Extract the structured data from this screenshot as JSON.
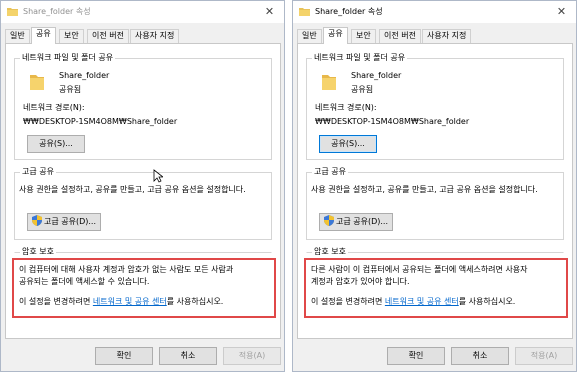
{
  "windows": [
    {
      "title": "Share_folder 속성",
      "close_glyph": "✕",
      "tabs": [
        "일반",
        "공유",
        "보안",
        "이전 버전",
        "사용자 지정"
      ],
      "network_share": {
        "group_label": "네트워크 파일 및 폴더 공유",
        "folder_name": "Share_folder",
        "folder_status": "공유됨",
        "path_label": "네트워크 경로(N):",
        "path_value": "₩₩DESKTOP-1SM4O8M₩Share_folder",
        "share_button": "공유(S)..."
      },
      "advanced_share": {
        "group_label": "고급 공유",
        "description": "사용 권한을 설정하고, 공유를 만들고, 고급 공유 옵션을 설정합니다.",
        "button": "고급 공유(D)..."
      },
      "password_protect": {
        "group_label": "암호 보호",
        "line1": "이 컴퓨터에 대해 사용자 계정과 암호가 없는 사람도 모든 사람과",
        "line2": "공유되는 폴더에 액세스할 수 있습니다.",
        "change_prefix": "이 설정을 변경하려면 ",
        "change_link": "네트워크 및 공유 센터",
        "change_suffix": "를 사용하십시오."
      },
      "footer": {
        "ok": "확인",
        "cancel": "취소",
        "apply": "적용(A)"
      }
    },
    {
      "title": "Share_folder 속성",
      "close_glyph": "✕",
      "tabs": [
        "일반",
        "공유",
        "보안",
        "이전 버전",
        "사용자 지정"
      ],
      "network_share": {
        "group_label": "네트워크 파일 및 폴더 공유",
        "folder_name": "Share_folder",
        "folder_status": "공유됨",
        "path_label": "네트워크 경로(N):",
        "path_value": "₩₩DESKTOP-1SM4O8M₩Share_folder",
        "share_button": "공유(S)..."
      },
      "advanced_share": {
        "group_label": "고급 공유",
        "description": "사용 권한을 설정하고, 공유를 만들고, 고급 공유 옵션을 설정합니다.",
        "button": "고급 공유(D)..."
      },
      "password_protect": {
        "group_label": "암호 보호",
        "line1": "다른 사람이 이 컴퓨터에서 공유되는 폴더에 액세스하려면 사용자",
        "line2": "계정과 암호가 있어야 합니다.",
        "change_prefix": "이 설정을 변경하려면 ",
        "change_link": "네트워크 및 공유 센터",
        "change_suffix": "를 사용하십시오."
      },
      "footer": {
        "ok": "확인",
        "cancel": "취소",
        "apply": "적용(A)"
      }
    }
  ],
  "colors": {
    "highlight": "#e04848",
    "link": "#0066cc",
    "focus": "#0078d7"
  }
}
